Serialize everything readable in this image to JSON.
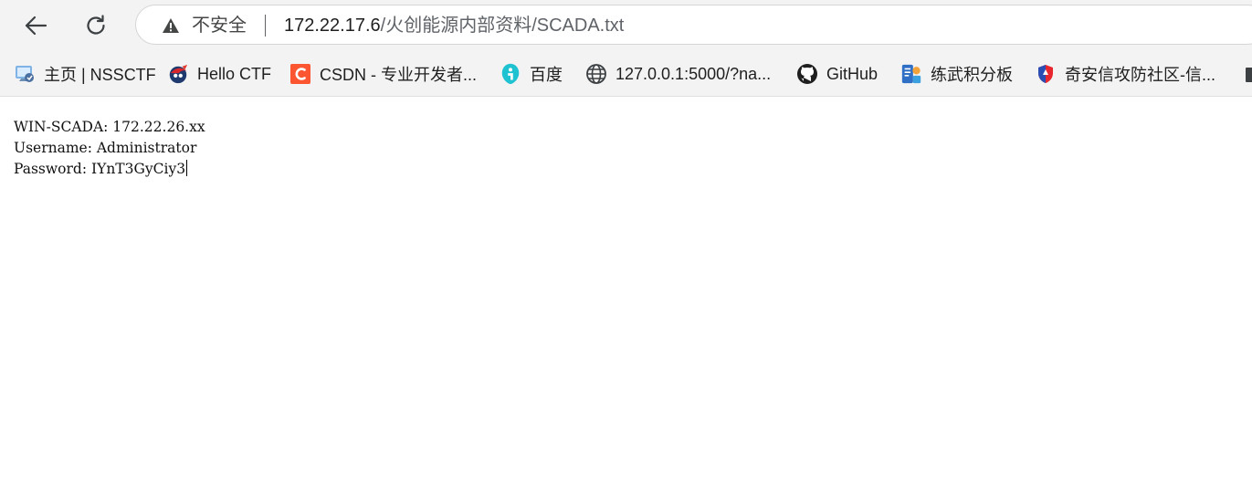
{
  "address_bar": {
    "security_label": "不安全",
    "url_host": "172.22.17.6",
    "url_path": "/火创能源内部资料/SCADA.txt"
  },
  "bookmarks": [
    {
      "label": "主页 | NSSCTF",
      "icon": "nssctf-icon"
    },
    {
      "label": "Hello CTF",
      "icon": "hello-ctf-icon"
    },
    {
      "label": "CSDN - 专业开发者...",
      "icon": "csdn-icon"
    },
    {
      "label": "百度",
      "icon": "baidu-icon"
    },
    {
      "label": "127.0.0.1:5000/?na...",
      "icon": "globe-icon"
    },
    {
      "label": "GitHub",
      "icon": "github-icon"
    },
    {
      "label": "练武积分板",
      "icon": "scoreboard-icon"
    },
    {
      "label": "奇安信攻防社区-信...",
      "icon": "qianxin-icon"
    }
  ],
  "document": {
    "lines": [
      "WIN-SCADA: 172.22.26.xx",
      "Username: Administrator",
      "Password: IYnT3GyCiy3"
    ]
  },
  "colors": {
    "toolbar_bg": "#f3f3f3",
    "csdn_orange": "#fc5531",
    "baidu_cyan": "#1fc2d1",
    "qianxin_red": "#e8262d"
  }
}
